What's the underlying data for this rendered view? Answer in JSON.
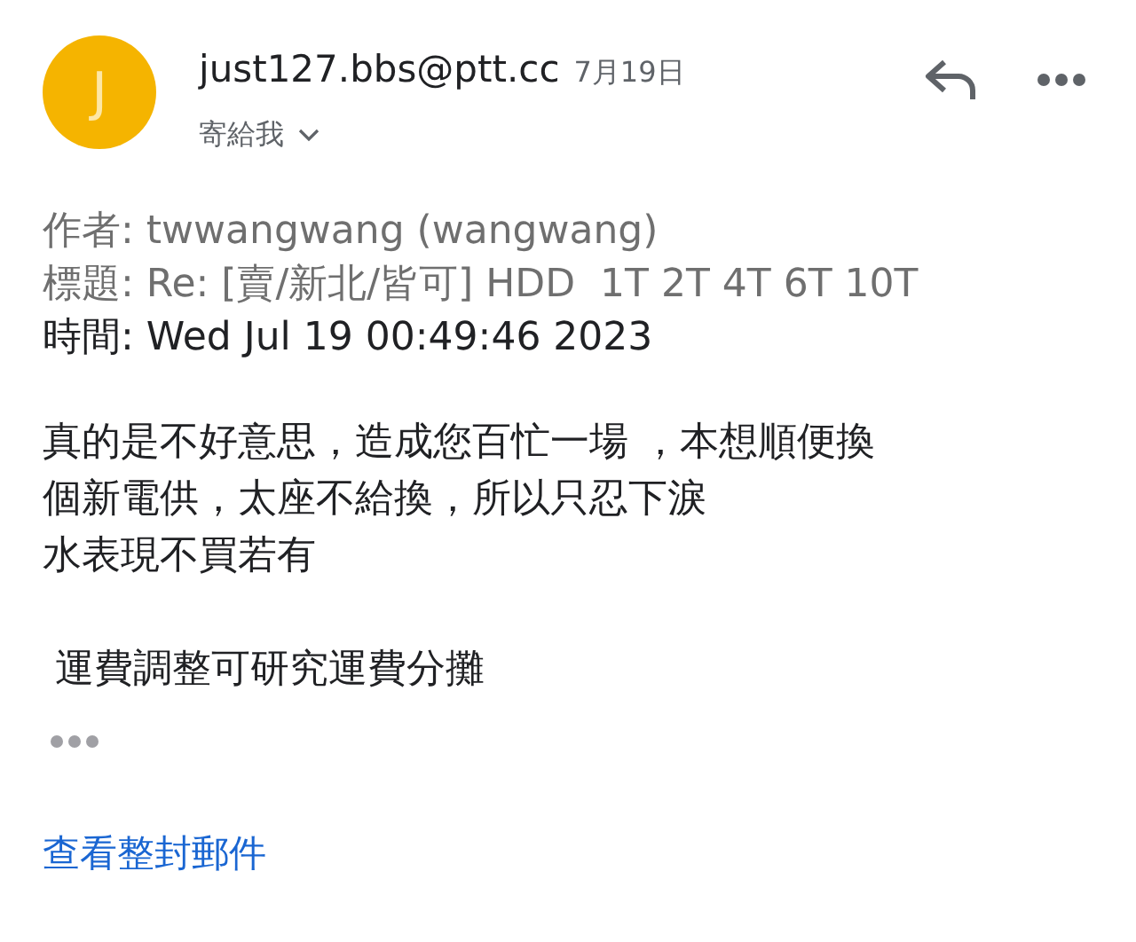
{
  "sender": {
    "avatar_letter": "J",
    "address": "just127.bbs@ptt.cc",
    "date": "7月19日",
    "recipient": "寄給我"
  },
  "headers": [
    {
      "label": "作者:",
      "value": "twwangwang (wangwang)",
      "muted": true
    },
    {
      "label": "標題:",
      "value": "Re: [賣/新北/皆可] HDD  1T 2T 4T 6T 10T",
      "muted": true
    },
    {
      "label": "時間:",
      "value": "Wed Jul 19 00:49:46 2023",
      "muted": false
    }
  ],
  "body": [
    {
      "lines": [
        "真的是不好意思，造成您百忙一場 ，本想順便換",
        "個新電供，太座不給換，所以只忍下淚",
        "水表現不買若有"
      ]
    },
    {
      "lines": [
        " 運費調整可研究運費分攤"
      ]
    }
  ],
  "view_full_link": "查看整封郵件"
}
